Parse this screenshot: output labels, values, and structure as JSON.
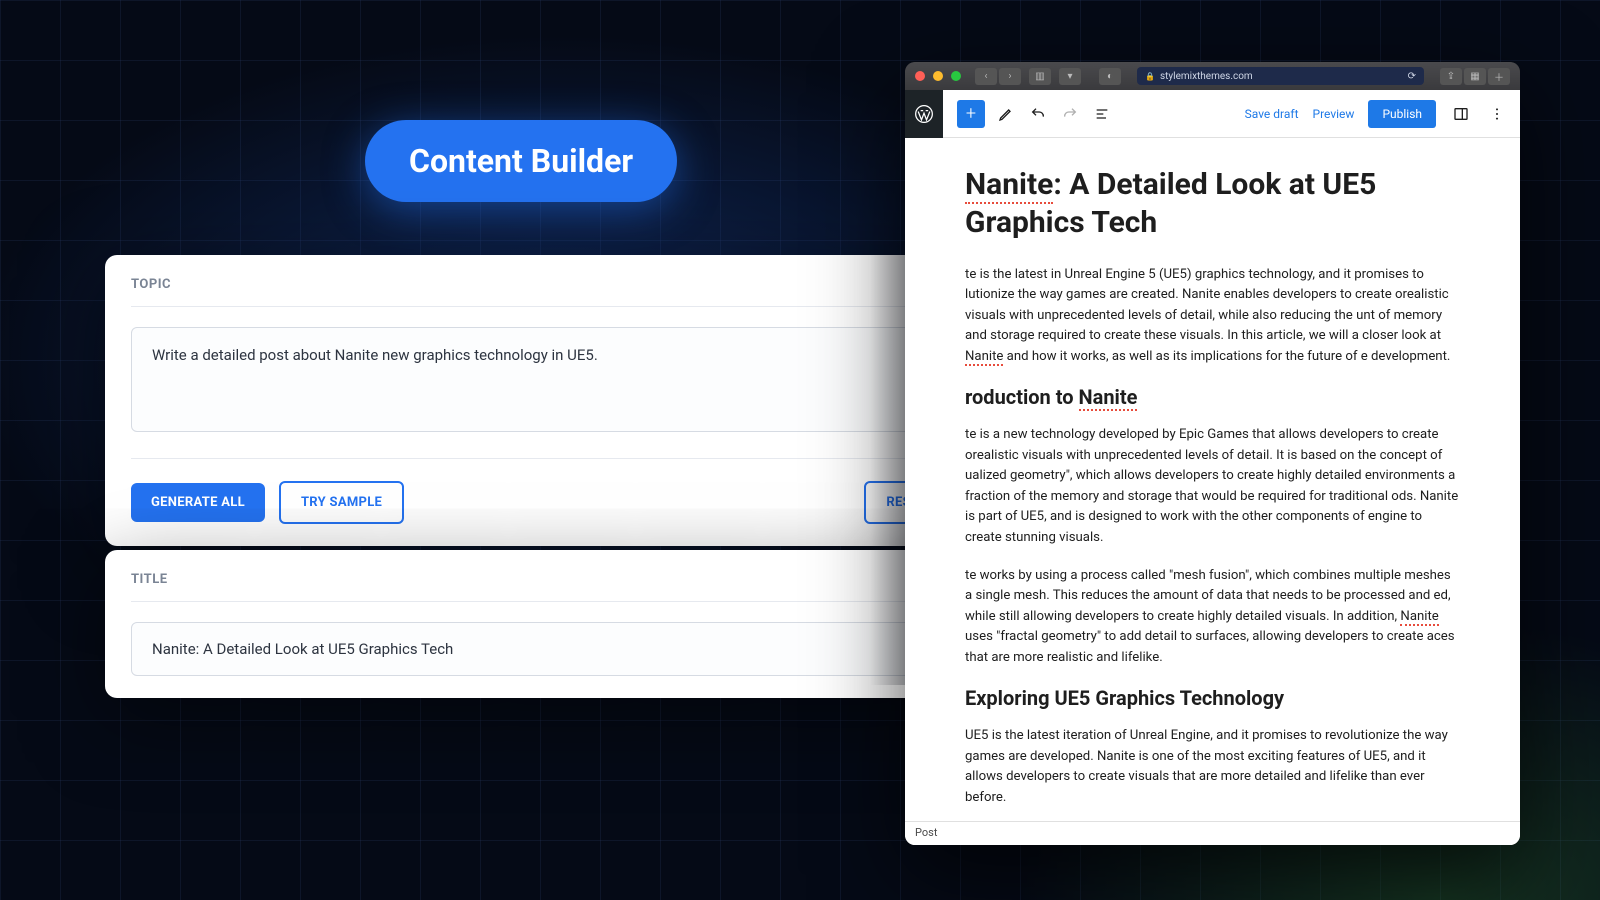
{
  "badge": "Content Builder",
  "builder": {
    "topic_label": "TOPIC",
    "topic_value": "Write a detailed post about Nanite new graphics technology in UE5.",
    "generate_all": "GENERATE ALL",
    "try_sample": "TRY SAMPLE",
    "reset": "RESET",
    "title_label": "TITLE",
    "title_value": "Nanite: A Detailed Look at UE5 Graphics Tech"
  },
  "browser": {
    "url": "stylemixthemes.com"
  },
  "wp": {
    "save_draft": "Save draft",
    "preview": "Preview",
    "publish": "Publish",
    "h1_a": "Nanite",
    "h1_b": ": A Detailed Look at UE5 Graphics Tech",
    "p1_a": "te is the latest in Unreal Engine 5 (UE5) graphics technology, and it promises to lutionize the way games are created. Nanite enables developers to create orealistic visuals with unprecedented levels of detail, while also reducing the unt of memory and storage required to create these visuals. In this article, we will a closer look at ",
    "p1_nanite": "Nanite",
    "p1_b": " and how it works, as well as its implications for the future of e development.",
    "h2a_a": "roduction to ",
    "h2a_nanite": "Nanite",
    "p2": "te is a new technology developed by Epic Games that allows developers to create orealistic visuals with unprecedented levels of detail. It is based on the concept of ualized geometry\", which allows developers to create highly detailed environments a fraction of the memory and storage that would be required for traditional ods. Nanite is part of UE5, and is designed to work with the other components of engine to create stunning visuals.",
    "p3_a": "te works by using a process called \"mesh fusion\", which combines multiple meshes a single mesh. This reduces the amount of data that needs to be processed and ed, while still allowing developers to create highly detailed visuals. In addition, ",
    "p3_nanite": "Nanite",
    "p3_b": " uses \"fractal geometry\" to add detail to surfaces, allowing developers to create aces that are more realistic and lifelike.",
    "h2b": "Exploring UE5 Graphics Technology",
    "p4": "UE5 is the latest iteration of Unreal Engine, and it promises to revolutionize the way games are developed. Nanite is one of the most exciting features of UE5, and it allows developers to create visuals that are more detailed and lifelike than ever before.",
    "footer": "Post"
  }
}
